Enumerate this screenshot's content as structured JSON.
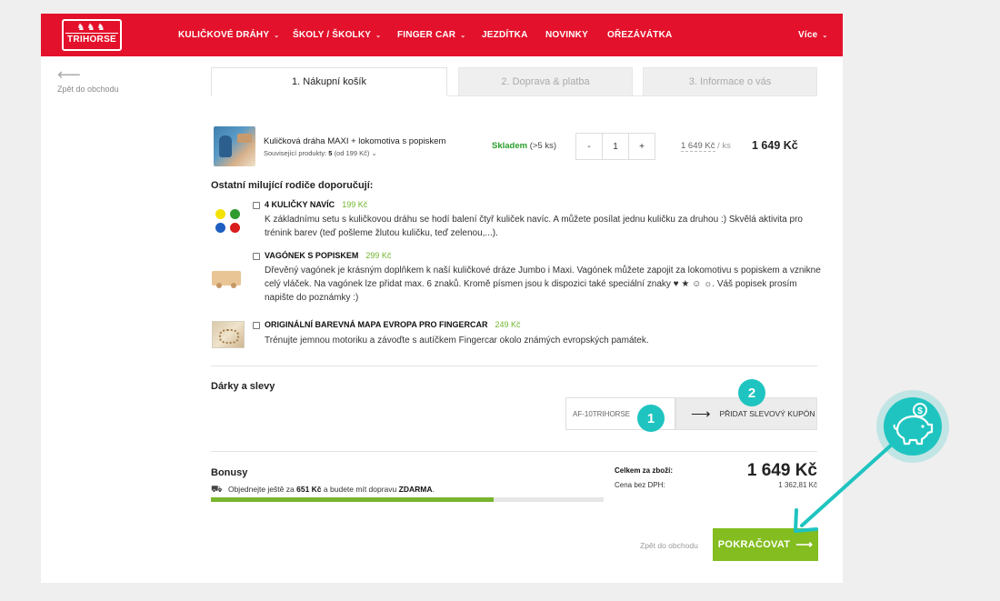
{
  "header": {
    "brand": "TRIHORSE",
    "horses": "♞♞♞",
    "nav": [
      {
        "label": "KULIČKOVÉ DRÁHY",
        "dropdown": true
      },
      {
        "label": "ŠKOLY / ŠKOLKY",
        "dropdown": true
      },
      {
        "label": "FINGER CAR",
        "dropdown": true
      },
      {
        "label": "JEZDÍTKA",
        "dropdown": false
      },
      {
        "label": "NOVINKY",
        "dropdown": false
      },
      {
        "label": "OŘEZÁVÁTKA",
        "dropdown": false
      }
    ],
    "more": "Více",
    "chevron": "⌄",
    "accent": "#e3112b"
  },
  "back_link": {
    "arrow": "⟵",
    "label": "Zpět do obchodu"
  },
  "tabs": [
    {
      "label": "1. Nákupní košík",
      "active": true
    },
    {
      "label": "2. Doprava & platba",
      "active": false
    },
    {
      "label": "3. Informace o vás",
      "active": false
    }
  ],
  "cart_item": {
    "name": "Kuličková dráha MAXI + lokomotiva s popiskem",
    "related_prefix": "Související produkty:",
    "related_count": "5",
    "related_from": "(od 199 Kč)",
    "related_chevron": "⌄",
    "stock_label": "Skladem",
    "stock_qty": "(>5 ks)",
    "qty_minus": "-",
    "qty": "1",
    "qty_plus": "+",
    "unit_price": "1 649 Kč",
    "unit_suffix": "/ ks",
    "total": "1 649 Kč"
  },
  "recommendations": {
    "title": "Ostatní milující rodiče doporučují:",
    "items": [
      {
        "title": "4 KULIČKY NAVÍC",
        "price": "199 Kč",
        "desc": "K základnímu setu s kuličkovou dráhu se hodí balení čtyř kuliček navíc. A můžete posílat jednu kuličku za druhou :) Skvělá aktivita pro trénink barev (teď pošleme žlutou kuličku, teď zelenou,...)."
      },
      {
        "title": "VAGÓNEK S POPISKEM",
        "price": "299 Kč",
        "desc": "Dřevěný vagónek je krásným doplňkem k naší kuličkové dráze Jumbo i Maxi. Vagónek můžete zapojit za lokomotivu s popiskem a vznikne celý vláček. Na vagónek lze přidat max. 6 znaků. Kromě písmen jsou k dispozici také speciální znaky ♥ ★ ☺ ☼. Váš popisek prosím napište do poznámky :)"
      },
      {
        "title": "ORIGINÁLNÍ BAREVNÁ MAPA EVROPA PRO FINGERCAR",
        "price": "249 Kč",
        "desc": "Trénujte jemnou motoriku a závoďte s autíčkem Fingercar okolo známých evropských památek."
      }
    ]
  },
  "gifts": {
    "title": "Dárky a slevy",
    "coupon_value": "AF-10TRIHORSE",
    "coupon_arrow": "⟶",
    "coupon_button": "PŘIDAT SLEVOVÝ KUPÓN",
    "badge_1": "1",
    "badge_2": "2"
  },
  "bonus": {
    "title": "Bonusy",
    "truck": "⛟",
    "msg_pre": "Objednejte ještě za",
    "msg_amount": "651 Kč",
    "msg_mid": "a budete mít dopravu",
    "msg_free": "ZDARMA",
    "msg_end": ".",
    "progress": 0.72
  },
  "summary": {
    "label_total": "Celkem za zboží:",
    "label_net": "Cena bez DPH:",
    "total": "1 649 Kč",
    "net": "1 362,81 Kč"
  },
  "footer": {
    "back": "Zpět do obchodu",
    "continue": "POKRAČOVAT",
    "continue_arrow": "⟶",
    "continue_color": "#83bd1f"
  },
  "overlay": {
    "icon": "piggy-bank-icon",
    "coin": "$",
    "color": "#1fc4c0"
  }
}
